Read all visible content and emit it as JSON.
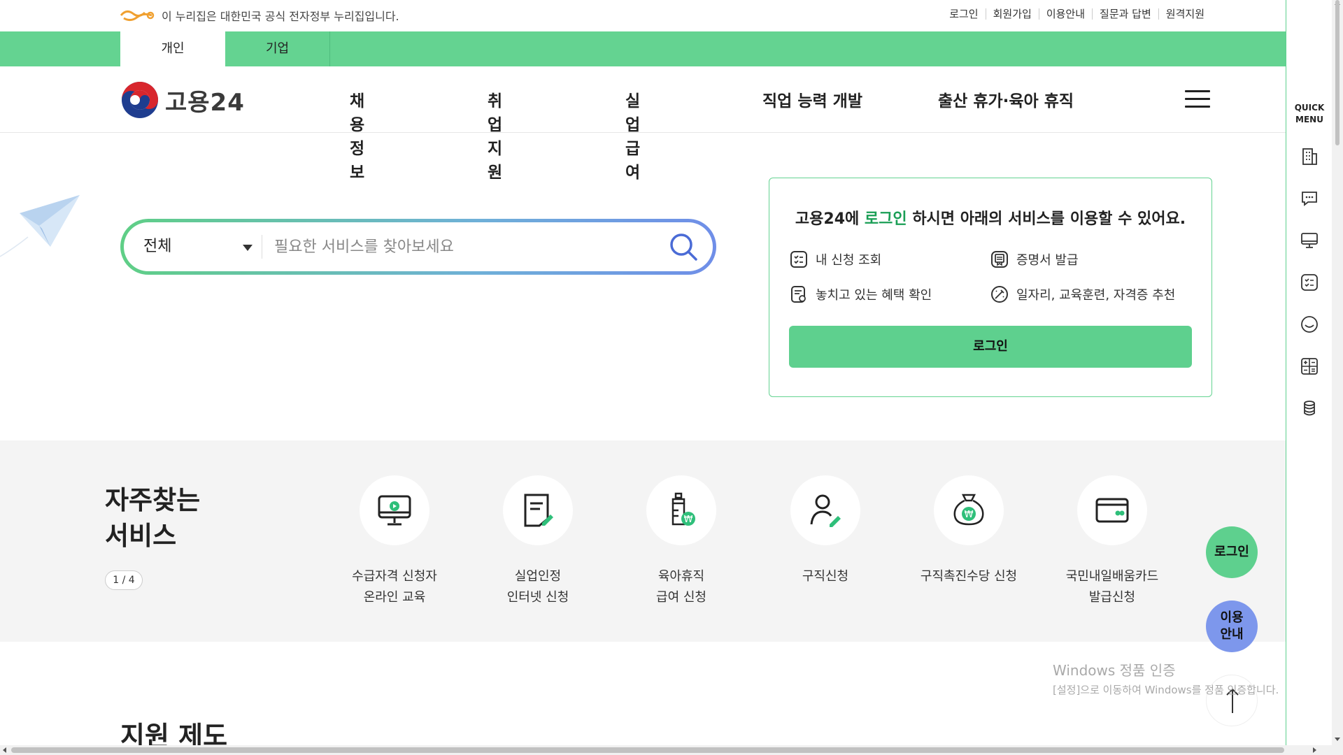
{
  "gov_banner": {
    "text": "이 누리집은 대한민국 공식 전자정부 누리집입니다.",
    "links": [
      "로그인",
      "회원가입",
      "이용안내",
      "질문과 답변",
      "원격지원"
    ]
  },
  "user_tabs": [
    "개인",
    "기업"
  ],
  "brand": {
    "name": "고용24"
  },
  "nav": [
    "채용정보",
    "취업지원",
    "실업급여",
    "직업 능력 개발",
    "출산 휴가·육아 휴직"
  ],
  "search": {
    "category": "전체",
    "placeholder": "필요한 서비스를 찾아보세요"
  },
  "login_box": {
    "title_prefix": "고용24에 ",
    "title_highlight": "로그인",
    "title_suffix": " 하시면 아래의 서비스를 이용할 수 있어요.",
    "features": [
      "내 신청 조회",
      "증명서 발급",
      "놓치고 있는 혜택 확인",
      "일자리, 교육훈련, 자격증 추천"
    ],
    "button": "로그인"
  },
  "frequent": {
    "title_line1": "자주찾는",
    "title_line2": "서비스",
    "pager": "1 / 4",
    "items": [
      {
        "label": "수급자격 신청자\n온라인 교육",
        "icon": "monitor-play-icon"
      },
      {
        "label": "실업인정\n인터넷 신청",
        "icon": "document-edit-icon"
      },
      {
        "label": "육아휴직\n급여 신청",
        "icon": "baby-bottle-won-icon"
      },
      {
        "label": "구직신청",
        "icon": "person-edit-icon"
      },
      {
        "label": "구직촉진수당 신청",
        "icon": "money-bag-won-icon"
      },
      {
        "label": "국민내일배움카드\n발급신청",
        "icon": "card-icon"
      }
    ]
  },
  "support_section": {
    "title": "지원 제도"
  },
  "floating": {
    "login": "로그인",
    "guide_line1": "이용",
    "guide_line2": "안내"
  },
  "quick_menu": {
    "title_line1": "QUICK",
    "title_line2": "MENU",
    "icons": [
      "building-icon",
      "chat-icon",
      "monitor-icon",
      "checklist-icon",
      "smile-icon",
      "calculator-icon",
      "coins-icon"
    ]
  },
  "watermark": {
    "line1": "Windows 정품 인증",
    "line2": "[설정]으로 이동하여 Windows를 정품 인증합니다."
  },
  "colors": {
    "accent_green": "#64d391",
    "accent_blue": "#7d97ec",
    "highlight_text": "#1a9e55"
  }
}
